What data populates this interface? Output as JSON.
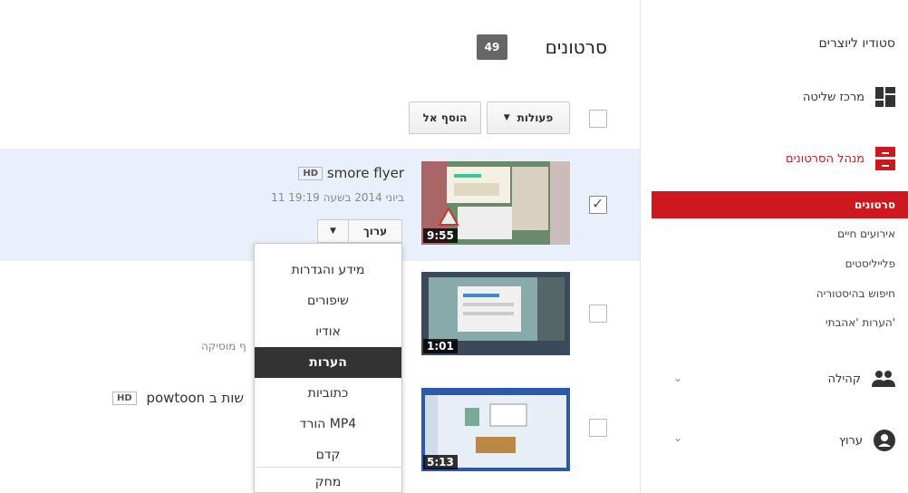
{
  "sidebar": {
    "studio_title": "סטודיו ליוצרים",
    "dashboard": "מרכז שליטה",
    "video_manager": "מנהל הסרטונים",
    "subnav": [
      "סרטונים",
      "אירועים חיים",
      "פלייליסטים",
      "חיפוש בהיסטוריה",
      "הערות 'אהבתי'"
    ],
    "community": "קהילה",
    "channel": "ערוץ",
    "chevron": "⌄"
  },
  "main": {
    "title": "סרטונים",
    "count": "49",
    "actions_label": "פעולות",
    "add_to_label": "הוסף אל"
  },
  "videos": [
    {
      "title": "smore flyer",
      "hd": "HD",
      "date": "11 ביוני 2014 בשעה 19:19",
      "duration": "9:55",
      "edit_label": "ערוך"
    },
    {
      "duration": "1:01",
      "fragment": "ף מוסיקה"
    },
    {
      "title": "powtoon שות ב",
      "hd": "HD",
      "duration": "5:13"
    }
  ],
  "edit_menu": [
    "מידע והגדרות",
    "שיפורים",
    "אודיו",
    "הערות",
    "כתוביות",
    "הורד MP4",
    "קדם",
    "מחק"
  ],
  "colors": {
    "accent": "#cc181e",
    "selected_row": "#e9f0fb",
    "menu_active": "#333333"
  }
}
